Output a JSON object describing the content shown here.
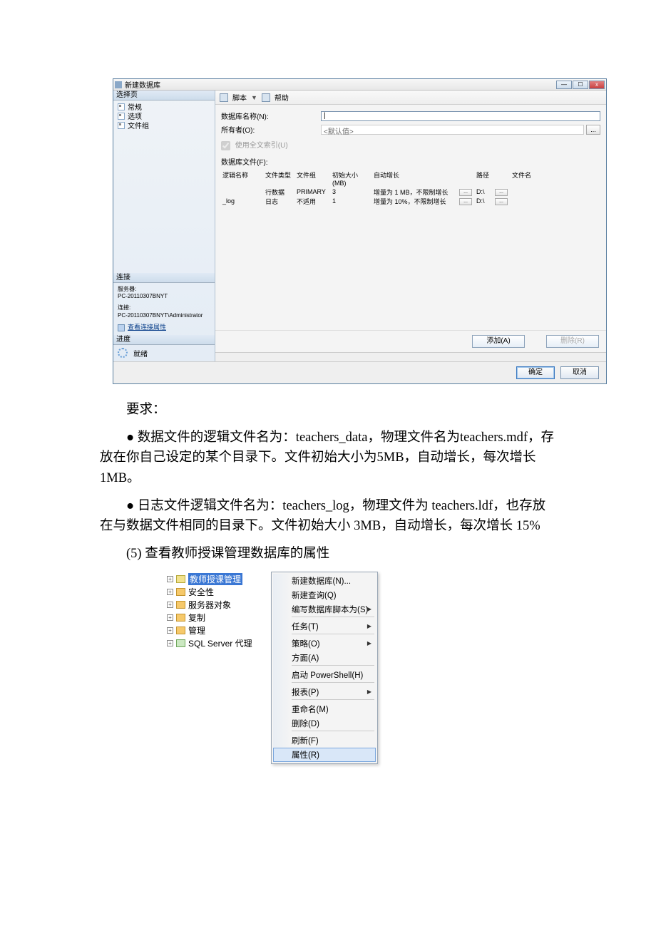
{
  "dialog": {
    "title": "新建数据库",
    "left_head1": "选择页",
    "left_items": [
      "常规",
      "选项",
      "文件组"
    ],
    "left_head2": "连接",
    "server_label": "服务器:",
    "server_value": "PC-20110307BNYT",
    "conn_label": "连接:",
    "conn_value": "PC-20110307BNYT\\Administrator",
    "view_conn": "查看连接属性",
    "progress_head": "进度",
    "ready": "就绪",
    "toolbar_script": "脚本",
    "toolbar_help": "帮助",
    "form": {
      "db_name_label": "数据库名称(N):",
      "owner_label": "所有者(O):",
      "owner_value": "<默认值>",
      "fulltext": "使用全文索引(U)",
      "dbfiles_label": "数据库文件(F):"
    },
    "grid": {
      "headers": [
        "逻辑名称",
        "文件类型",
        "文件组",
        "初始大小(MB)",
        "自动增长",
        "",
        "路径",
        "",
        "文件名"
      ],
      "rows": [
        {
          "name": "",
          "type": "行数据",
          "group": "PRIMARY",
          "size": "3",
          "auto": "增量为 1 MB，不限制增长",
          "path": "D:\\"
        },
        {
          "name": "_log",
          "type": "日志",
          "group": "不适用",
          "size": "1",
          "auto": "增量为 10%，不限制增长",
          "path": "D:\\"
        }
      ]
    },
    "add_btn": "添加(A)",
    "del_btn": "删除(R)",
    "ok": "确定",
    "cancel": "取消"
  },
  "doc": {
    "p1": "要求：",
    "p2": "● 数据文件的逻辑文件名为：teachers_data，物理文件名为teachers.mdf，存放在你自己设定的某个目录下。文件初始大小为5MB，自动增长，每次增长 1MB。",
    "p3": "● 日志文件逻辑文件名为：teachers_log，物理文件为 teachers.ldf，也存放在与数据文件相同的目录下。文件初始大小 3MB，自动增长，每次增长 15%",
    "p4": "(5) 查看教师授课管理数据库的属性"
  },
  "tree": {
    "items": [
      {
        "label": "教师授课管理",
        "sel": true,
        "icon": "db"
      },
      {
        "label": "安全性",
        "icon": "fldr"
      },
      {
        "label": "服务器对象",
        "icon": "fldr"
      },
      {
        "label": "复制",
        "icon": "fldr"
      },
      {
        "label": "管理",
        "icon": "fldr"
      },
      {
        "label": "SQL Server 代理",
        "icon": "agent"
      }
    ]
  },
  "menu": {
    "items": [
      {
        "label": "新建数据库(N)..."
      },
      {
        "label": "新建查询(Q)"
      },
      {
        "label": "编写数据库脚本为(S)",
        "arrow": true
      },
      {
        "sep": true
      },
      {
        "label": "任务(T)",
        "arrow": true
      },
      {
        "sep": true
      },
      {
        "label": "策略(O)",
        "arrow": true
      },
      {
        "label": "方面(A)"
      },
      {
        "sep": true
      },
      {
        "label": "启动 PowerShell(H)"
      },
      {
        "sep": true
      },
      {
        "label": "报表(P)",
        "arrow": true
      },
      {
        "sep": true
      },
      {
        "label": "重命名(M)"
      },
      {
        "label": "删除(D)"
      },
      {
        "sep": true
      },
      {
        "label": "刷新(F)"
      },
      {
        "label": "属性(R)",
        "sel": true
      }
    ]
  }
}
